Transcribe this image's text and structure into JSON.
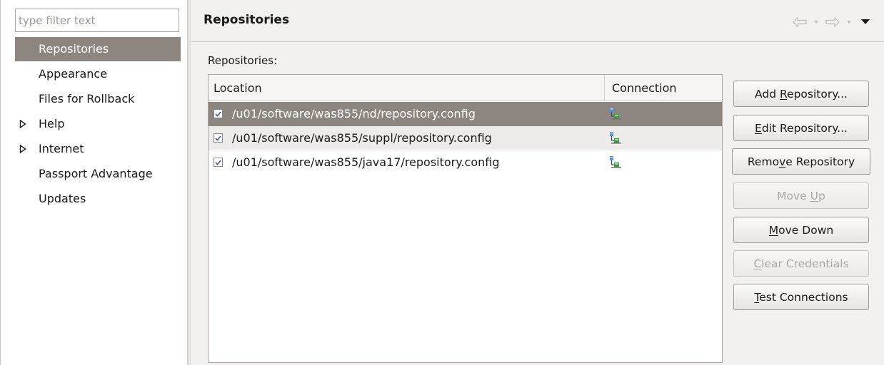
{
  "filter": {
    "placeholder": "type filter text"
  },
  "nav": {
    "items": [
      {
        "label": "Repositories",
        "selected": true,
        "expandable": false
      },
      {
        "label": "Appearance",
        "selected": false,
        "expandable": false
      },
      {
        "label": "Files for Rollback",
        "selected": false,
        "expandable": false
      },
      {
        "label": "Help",
        "selected": false,
        "expandable": true
      },
      {
        "label": "Internet",
        "selected": false,
        "expandable": true
      },
      {
        "label": "Passport Advantage",
        "selected": false,
        "expandable": false
      },
      {
        "label": "Updates",
        "selected": false,
        "expandable": false
      }
    ]
  },
  "page": {
    "title": "Repositories",
    "section_label": "Repositories:",
    "nav_icons": [
      "back-arrow-icon",
      "back-dropdown-icon",
      "forward-arrow-icon",
      "forward-dropdown-icon",
      "view-menu-icon"
    ]
  },
  "table": {
    "columns": [
      "Location",
      "Connection"
    ],
    "rows": [
      {
        "checked": true,
        "location": "/u01/software/was855/nd/repository.config",
        "connection_icon": "repository-connection-icon",
        "selected": true
      },
      {
        "checked": true,
        "location": "/u01/software/was855/suppl/repository.config",
        "connection_icon": "repository-connection-icon",
        "selected": false
      },
      {
        "checked": true,
        "location": "/u01/software/was855/java17/repository.config",
        "connection_icon": "repository-connection-icon",
        "selected": false
      }
    ]
  },
  "buttons": {
    "add": {
      "label": "Add Repository...",
      "enabled": true
    },
    "edit": {
      "label": "Edit Repository...",
      "enabled": true
    },
    "remove": {
      "label": "Remove Repository",
      "enabled": true
    },
    "move_up": {
      "label": "Move Up",
      "enabled": false
    },
    "move_down": {
      "label": "Move Down",
      "enabled": true
    },
    "clear": {
      "label": "Clear Credentials",
      "enabled": false
    },
    "test": {
      "label": "Test Connections",
      "enabled": true
    }
  },
  "colors": {
    "selection": "#8c8580",
    "alt_row": "#edecea",
    "background": "#f2f1f0",
    "disabled_text": "#aaa8a4"
  }
}
